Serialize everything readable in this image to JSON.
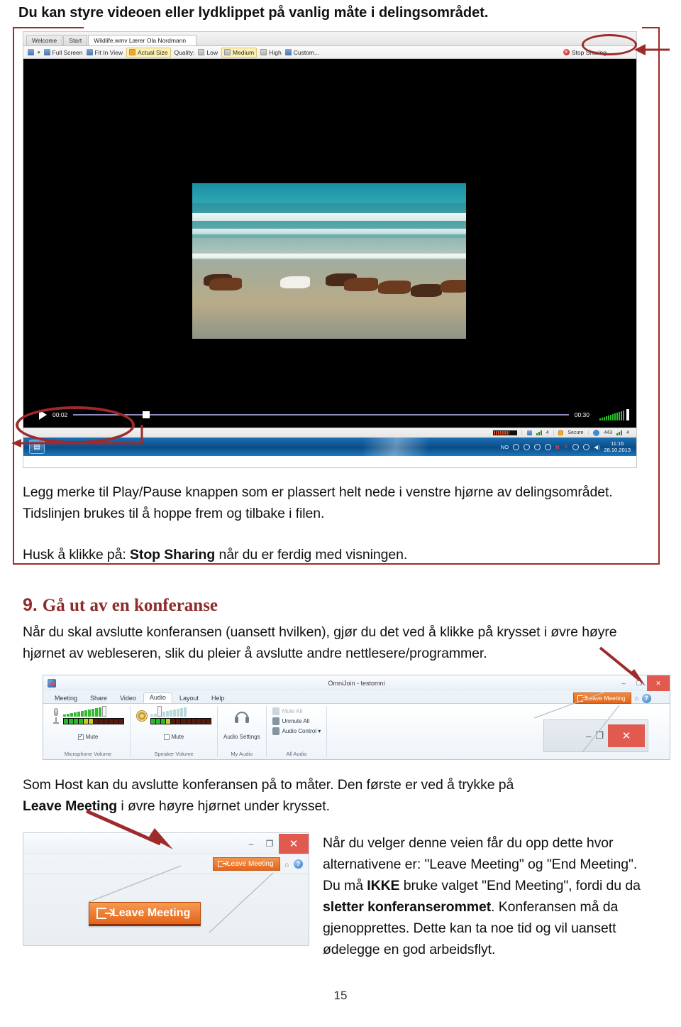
{
  "document": {
    "intro_line": "Du kan styre videoen eller lydklippet på vanlig måte i delingsområdet.",
    "para1_line1": "Legg merke til Play/Pause knappen som er plassert helt nede i venstre hjørne av delingsområdet.",
    "para1_line2": "Tidslinjen brukes til å hoppe frem og tilbake i filen.",
    "para2_prefix": "Husk å klikke på: ",
    "para2_bold": "Stop Sharing",
    "para2_suffix": " når du er ferdig med visningen.",
    "heading9_num": "9. ",
    "heading9_text": "Gå ut av en konferanse",
    "para3_line1": "Når du skal avslutte konferansen (uansett hvilken), gjør du det ved å klikke på krysset i øvre høyre",
    "para3_line2": "hjørnet av webleseren, slik du pleier å avslutte andre nettlesere/programmer.",
    "para4_line1": "Som Host kan du avslutte konferansen på to måter. Den første er ved å trykke på",
    "para4_bold": "Leave Meeting",
    "para4_rest": " i øvre høyre hjørnet under krysset.",
    "para5_l1": "Når du velger denne veien får du opp dette hvor",
    "para5_l2": "alternativene er: \"Leave Meeting\" og \"End Meeting\".",
    "para5_l3a": "Du må ",
    "para5_l3b": "IKKE",
    "para5_l3c": " bruke valget \"End Meeting\", fordi du da",
    "para5_l4a": "sletter konferanserommet",
    "para5_l4b": ". Konferansen må da",
    "para5_l5": "gjenopprettes. Dette kan ta noe tid og vil uansett",
    "para5_l6": "ødelegge en god arbeidsflyt.",
    "page_number": "15",
    "accent_color": "#9e2a2b",
    "heading_color": "#8e2b2b"
  },
  "screenshot_video": {
    "tabs": [
      {
        "label": "Welcome",
        "active": false
      },
      {
        "label": "Start",
        "active": false
      },
      {
        "label": "Wildlife.wmv Lærer Ola Nordmann",
        "active": true
      }
    ],
    "toolbar": {
      "dropdown_caret": "▾",
      "full_screen": "Full Screen",
      "fit_in_view": "Fit In View",
      "actual_size": "Actual Size",
      "actual_size_badge": "1:1",
      "quality_label": "Quality:",
      "low": "Low",
      "medium": "Medium",
      "high": "High",
      "custom": "Custom...",
      "stop_sharing": "Stop Sharing",
      "stop_sharing_icon": "x"
    },
    "player": {
      "play_icon": "play-triangle",
      "current_time": "00:02",
      "total_time": "00:30",
      "progress_percent": 14
    },
    "statusbar": {
      "count_left": "4",
      "secure": "Secure",
      "port": "443",
      "count_right": "4"
    },
    "taskbar": {
      "lang": "NO",
      "clock_time": "11:16",
      "clock_date": "28.10.2013"
    }
  },
  "screenshot_omnijoin": {
    "title": "OmniJoin - testomni",
    "window_controls": {
      "minimize": "–",
      "maximize": "❐",
      "close": "✕"
    },
    "tabs": [
      {
        "label": "Meeting",
        "active": false
      },
      {
        "label": "Share",
        "active": false
      },
      {
        "label": "Video",
        "active": false
      },
      {
        "label": "Audio",
        "active": true
      },
      {
        "label": "Layout",
        "active": false
      },
      {
        "label": "Help",
        "active": false
      }
    ],
    "leave_meeting": "Leave Meeting",
    "help_icon": "?",
    "home_icon": "⌂",
    "groups": [
      {
        "label": "Microphone Volume",
        "mute": "Mute",
        "muted": true
      },
      {
        "label": "Speaker Volume",
        "mute": "Mute",
        "muted": false
      },
      {
        "label": "My Audio",
        "button": "Audio Settings"
      },
      {
        "label": "All Audio",
        "items": [
          {
            "label": "Mute All",
            "disabled": true
          },
          {
            "label": "Unmute All",
            "disabled": false
          },
          {
            "label": "Audio Control ▾",
            "disabled": false
          }
        ]
      }
    ],
    "magnifier": {
      "minimize": "–",
      "maximize": "❐",
      "close": "✕"
    }
  },
  "screenshot_leave_detail": {
    "window_controls": {
      "minimize": "–",
      "maximize": "❐",
      "close": "✕"
    },
    "leave_meeting_small": "Leave Meeting",
    "leave_meeting_big": "Leave Meeting",
    "help_icon": "?",
    "home_icon": "⌂"
  }
}
